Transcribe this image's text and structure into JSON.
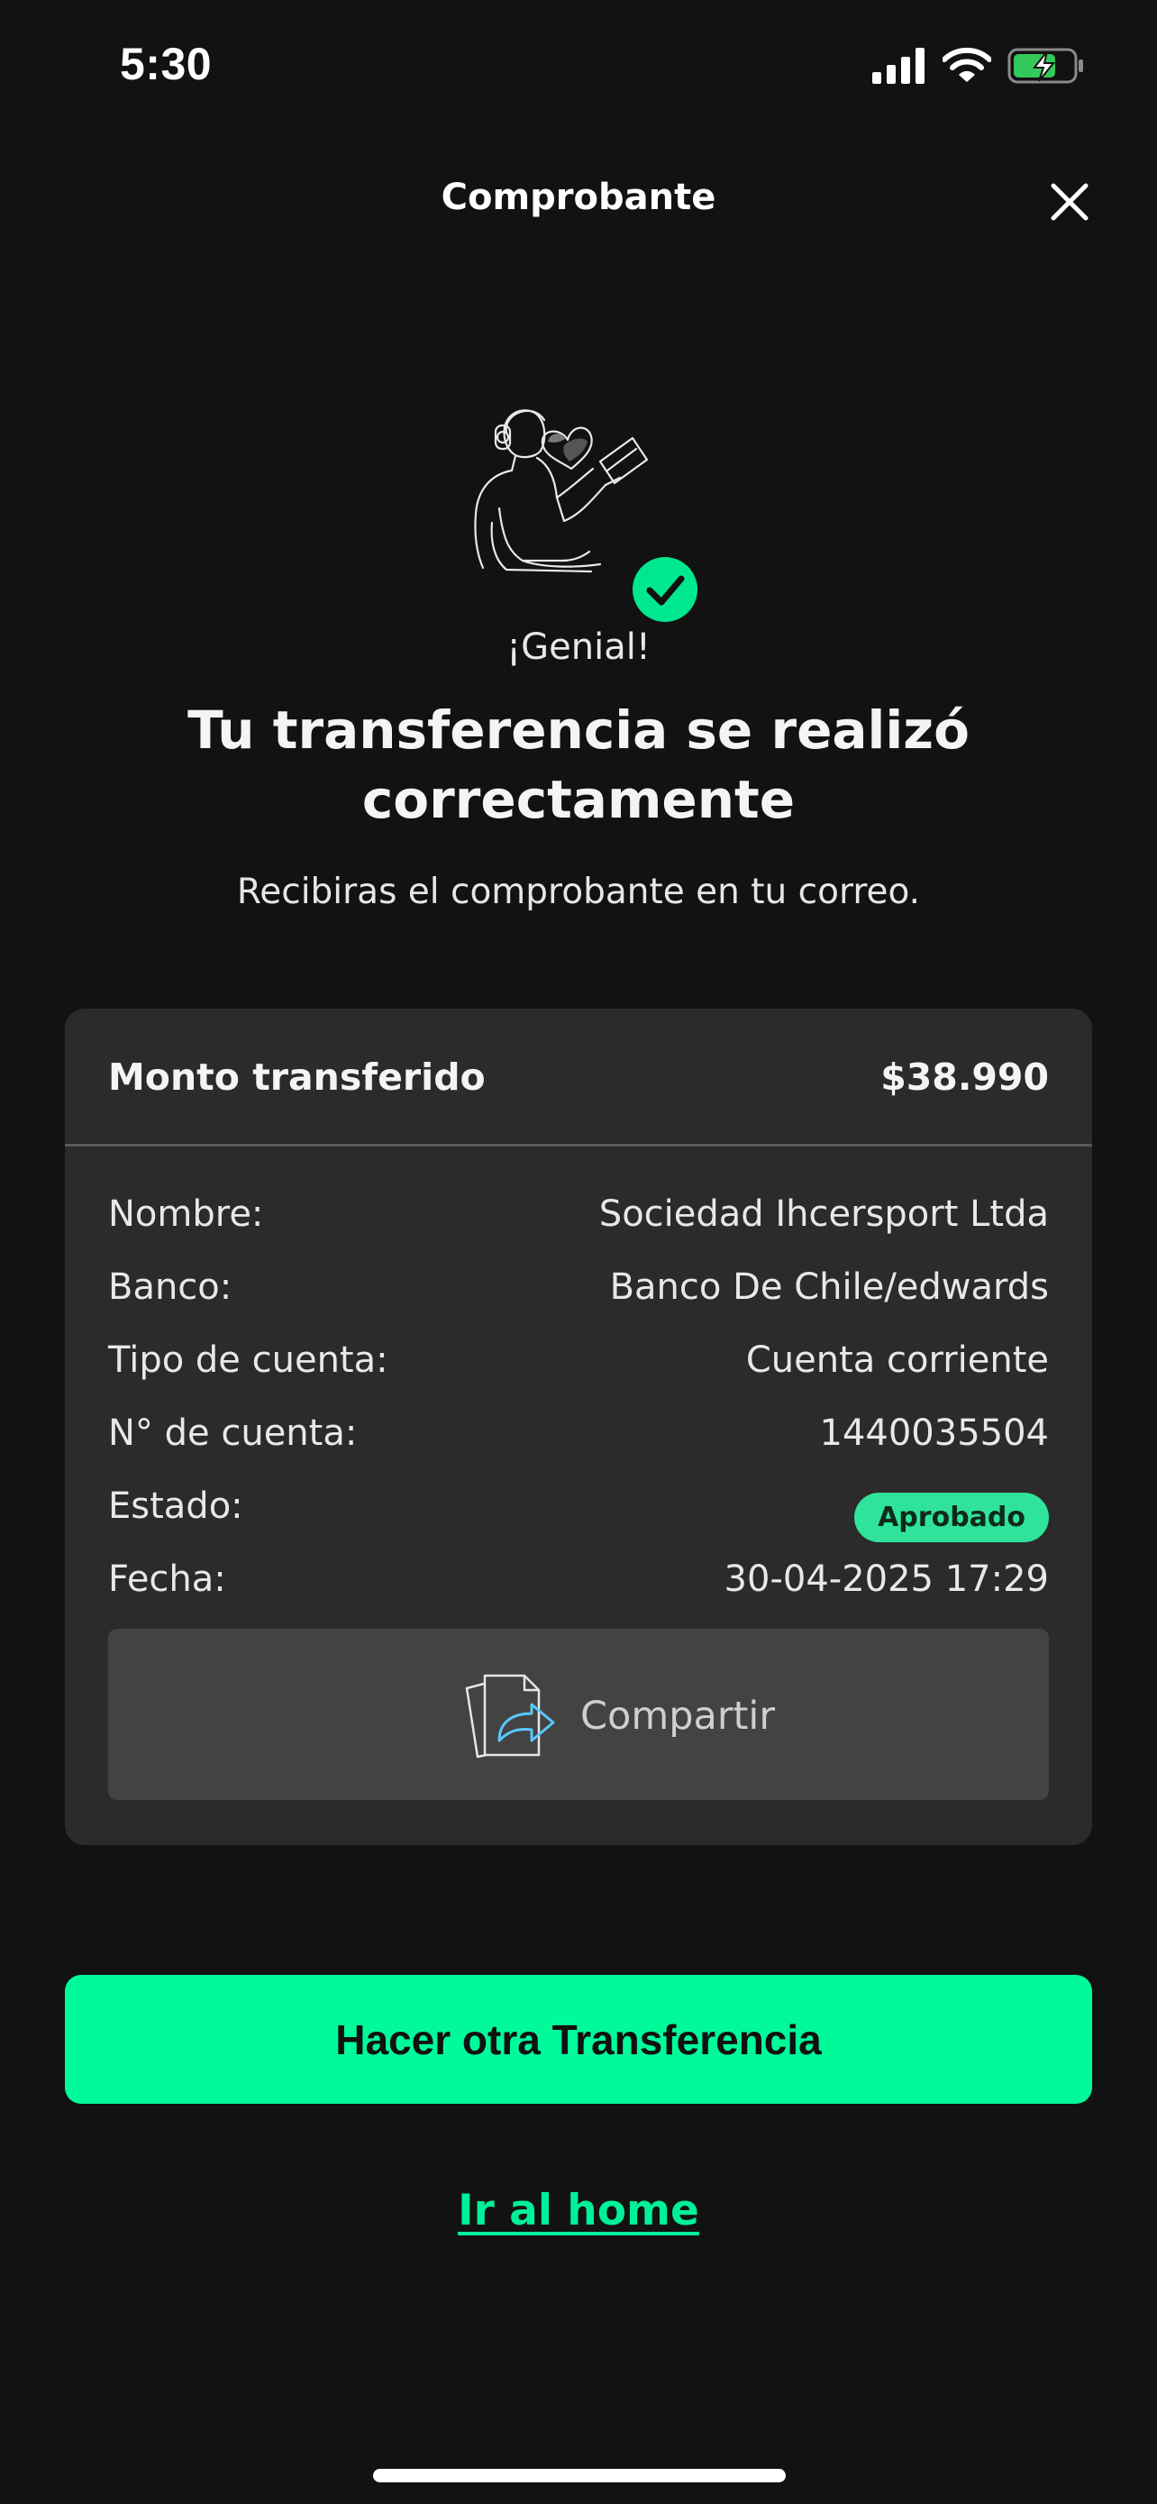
{
  "status_bar": {
    "time": "5:30",
    "icons": [
      "cellular-signal-icon",
      "wifi-icon",
      "battery-charging-icon"
    ]
  },
  "header": {
    "title": "Comprobante",
    "close_icon": "close-icon"
  },
  "hero": {
    "illustration": "person-with-phone-and-heart-illustration",
    "check_icon": "check-circle-icon",
    "exclamation": "¡Genial!",
    "headline": "Tu transferencia se realizó correctamente",
    "subtext": "Recibiras el comprobante en tu correo."
  },
  "receipt": {
    "amount_label": "Monto transferido",
    "amount_value": "$38.990",
    "rows": [
      {
        "label": "Nombre:",
        "value": "Sociedad Ihcersport Ltda"
      },
      {
        "label": "Banco:",
        "value": "Banco De Chile/edwards"
      },
      {
        "label": "Tipo de cuenta:",
        "value": "Cuenta corriente"
      },
      {
        "label": "N° de cuenta:",
        "value": "1440035504"
      },
      {
        "label": "Estado:",
        "value": "Aprobado"
      },
      {
        "label": "Fecha:",
        "value": "30-04-2025 17:29"
      }
    ],
    "share_label": "Compartir",
    "share_icon": "share-document-icon"
  },
  "actions": {
    "primary_label": "Hacer otra Transferencia",
    "home_link": "Ir al home"
  },
  "colors": {
    "background": "#121212",
    "card": "#2b2b2b",
    "accent": "#00fa9a",
    "badge": "#2fe49a"
  }
}
